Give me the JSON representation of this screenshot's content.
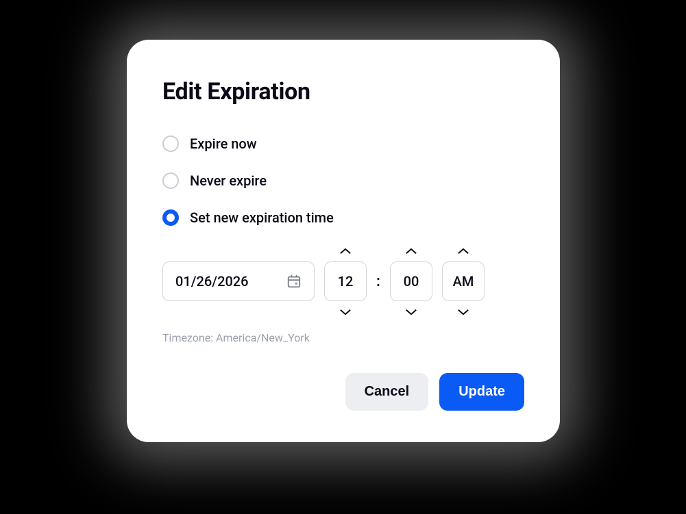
{
  "dialog": {
    "title": "Edit Expiration",
    "options": {
      "expire_now": "Expire now",
      "never_expire": "Never expire",
      "set_new": "Set new expiration time"
    },
    "date_value": "01/26/2026",
    "time": {
      "hour": "12",
      "minute": "00",
      "period": "AM"
    },
    "timezone_label": "Timezone: America/New_York",
    "actions": {
      "cancel": "Cancel",
      "update": "Update"
    }
  }
}
